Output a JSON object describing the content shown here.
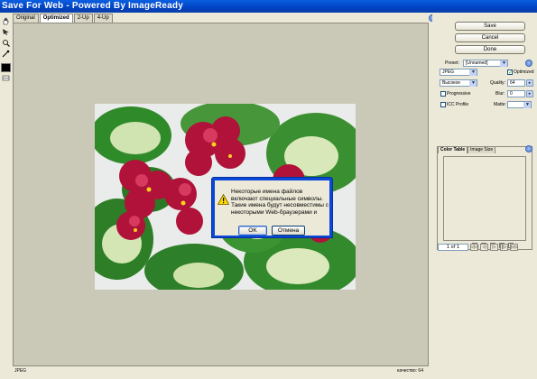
{
  "window": {
    "title": "Save For Web - Powered By ImageReady"
  },
  "tabs": [
    "Original",
    "Optimized",
    "2-Up",
    "4-Up"
  ],
  "active_tab": "Optimized",
  "tools": [
    {
      "name": "hand-tool-icon",
      "glyph": "✋"
    },
    {
      "name": "slice-select-tool-icon",
      "glyph": "↖"
    },
    {
      "name": "zoom-tool-icon",
      "glyph": "🔍"
    },
    {
      "name": "eyedropper-tool-icon",
      "glyph": "✎"
    }
  ],
  "buttons": {
    "save": "Save",
    "cancel": "Cancel",
    "done": "Done"
  },
  "settings": {
    "preset_label": "Preset:",
    "preset_value": "[Unnamed]",
    "optimized_label": "Optimized",
    "optimized_checked": true,
    "format": "JPEG",
    "quality_preset": "Высокое",
    "quality_label": "Quality:",
    "quality_value": "64",
    "progressive_label": "Progressive",
    "blur_label": "Blur:",
    "blur_value": "0",
    "icc_label": "ICC Profile",
    "matte_label": "Matte:"
  },
  "color_table": {
    "tab_color_table": "Color Table",
    "tab_image_size": "Image Size"
  },
  "pager": {
    "text": "1 of 1"
  },
  "status": {
    "format": "JPEG",
    "quality": "качество: 64"
  },
  "dialog": {
    "message": "Некоторые имена файлов включают специальные символы.  Такие имена будут несовместимы с некоторыми Web-браузерами и",
    "ok": "OK",
    "cancel": "Отмена"
  },
  "colors": {
    "title_blue": "#0042c4",
    "canvas": "#cac8b6",
    "petal": "#b0123a",
    "leaf": "#3a8a2e"
  }
}
